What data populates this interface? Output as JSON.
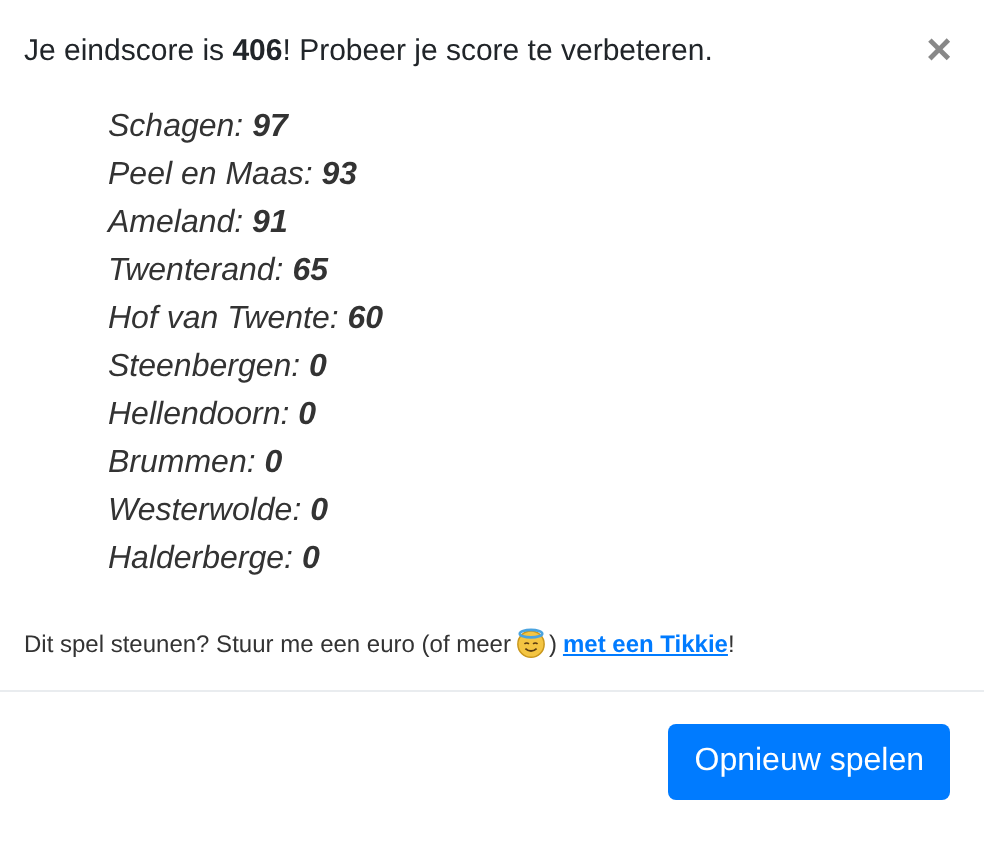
{
  "title": "Je eindscore is **406**! Probeer je score te verbeteren.",
  "close": "×",
  "scores": [
    {
      "text": "Schagen: **97**"
    },
    {
      "text": "Peel en Maas: **93**"
    },
    {
      "text": "Ameland: **91**"
    },
    {
      "text": "Twenterand: **65**"
    },
    {
      "text": "Hof van Twente: **60**"
    },
    {
      "text": "Steenbergen: **0**"
    },
    {
      "text": "Hellendoorn: **0**"
    },
    {
      "text": "Brummen: **0**"
    },
    {
      "text": "Westerwolde: **0**"
    },
    {
      "text": "Halderberge: **0**"
    }
  ],
  "support": {
    "before": "Dit spel steunen? Stuur me een euro (of meer",
    "after_icon": ")",
    "link": "met een Tikkie",
    "end": "!"
  },
  "button": "Opnieuw spelen"
}
